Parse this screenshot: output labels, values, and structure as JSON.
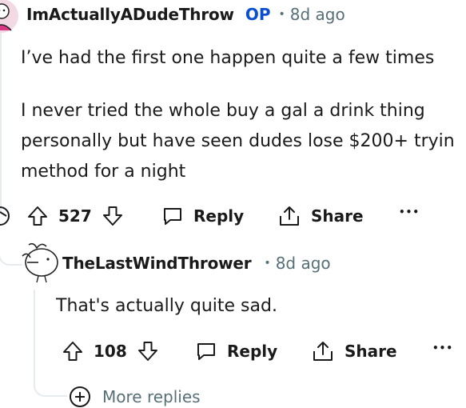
{
  "comment": {
    "author": "ImActuallyADudeThrow",
    "op_badge": "OP",
    "separator": "•",
    "time": "8d ago",
    "paragraphs": [
      "I’ve had the first one happen quite a few times",
      "I never tried the whole buy a gal a drink thing",
      "personally but have seen dudes lose $200+ tryin",
      "method for a night"
    ],
    "votes": "527",
    "reply_label": "Reply",
    "share_label": "Share",
    "more_label": "•••"
  },
  "reply": {
    "author": "TheLastWindThrower",
    "separator": "•",
    "time": "8d ago",
    "text": "That's actually quite sad.",
    "votes": "108",
    "reply_label": "Reply",
    "share_label": "Share",
    "more_label": "•••"
  },
  "more_replies_label": "More replies"
}
